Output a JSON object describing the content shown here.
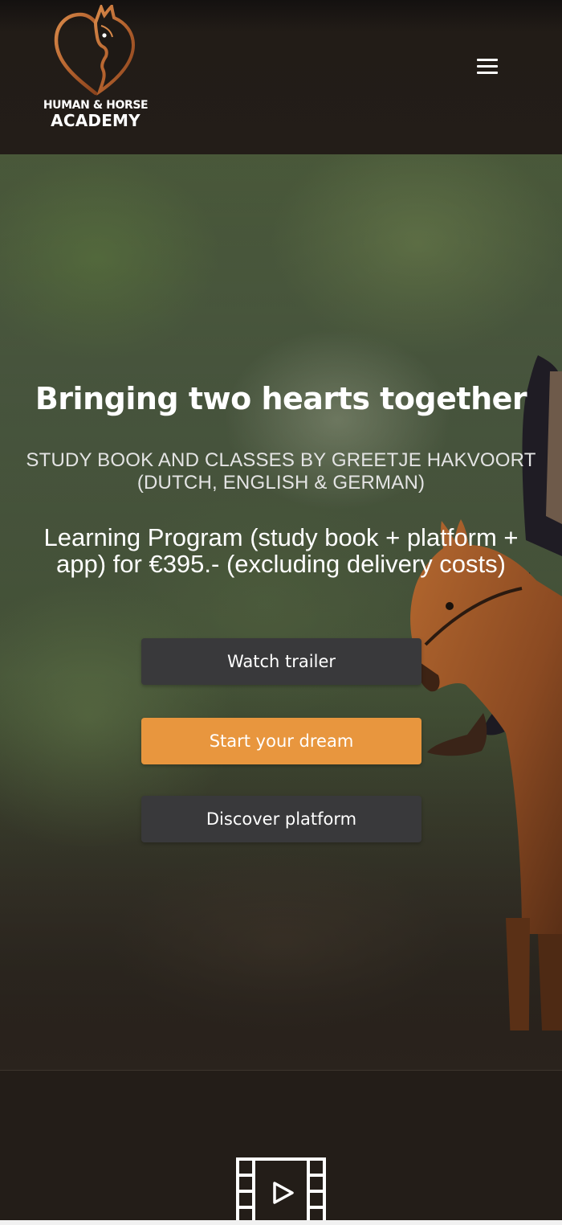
{
  "header": {
    "logo": {
      "line1": "HUMAN & HORSE",
      "line2": "ACADEMY",
      "icon": "horse-heart-logo"
    },
    "menu_icon": "hamburger-menu-icon"
  },
  "hero": {
    "title": "Bringing two hearts together",
    "subtitle_lines": [
      "STUDY BOOK AND CLASSES BY GREETJE HAKVOORT",
      "(DUTCH, ENGLISH & GERMAN)"
    ],
    "price_lines": [
      "Learning Program (study book + platform +",
      "app) for €395.- (excluding delivery costs)"
    ],
    "buttons": {
      "watch_trailer": "Watch trailer",
      "start_dream": "Start your dream",
      "discover_platform": "Discover platform"
    }
  },
  "next_section": {
    "icon": "video-film-icon"
  },
  "colors": {
    "background": "#231d18",
    "accent_orange": "#e8963e",
    "button_dark": "#39393b",
    "logo_copper": "#b96a35"
  }
}
